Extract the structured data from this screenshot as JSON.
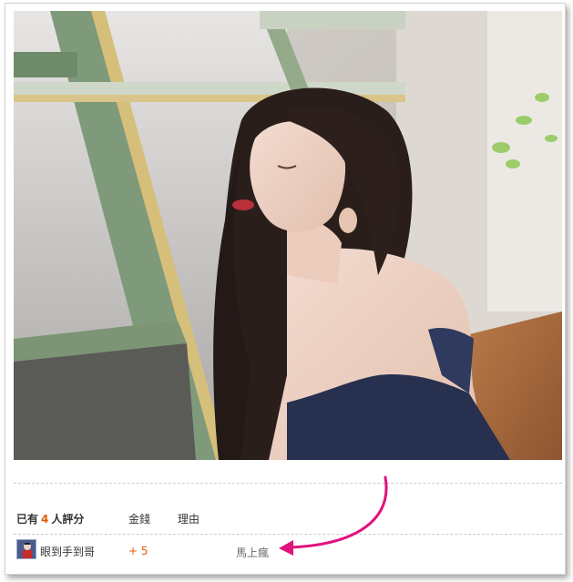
{
  "rating": {
    "prefix": "已有",
    "count": "4",
    "suffix": "人評分",
    "col_money": "金錢",
    "col_reason": "理由"
  },
  "entries": [
    {
      "user": "眼到手到哥",
      "score": "+ 5",
      "reason": "馬上瘋"
    }
  ],
  "colors": {
    "count_accent": "#e25c00",
    "arrow": "#e0127e"
  },
  "icons": {
    "avatar": "user-avatar-icon",
    "arrow": "annotation-arrow-icon"
  }
}
